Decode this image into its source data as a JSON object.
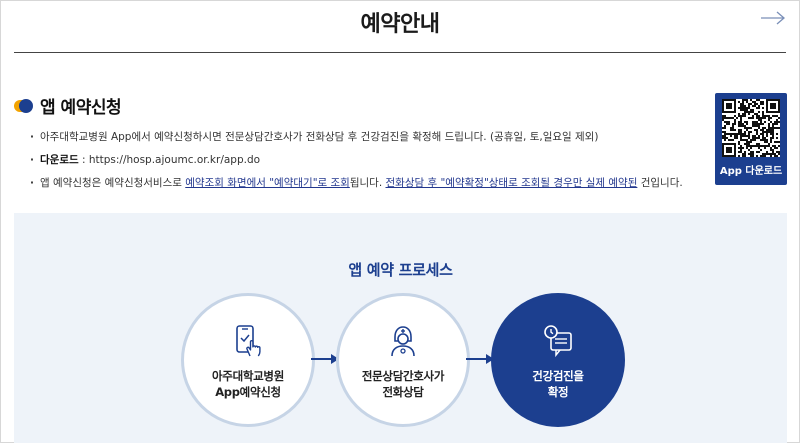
{
  "header": {
    "title": "예약안내",
    "next_icon": "arrow-right-icon"
  },
  "section": {
    "title": "앱 예약신청",
    "icon": "section-bullet-icon"
  },
  "info": {
    "line1": "아주대학교병원 App에서 예약신청하시면 전문상담간호사가 전화상담 후 건강검진을 확정해 드립니다. (공휴일, 토,일요일 제외)",
    "download_label": "다운로드",
    "download_sep": " : ",
    "download_url": "https://hosp.ajoumc.or.kr/app.do",
    "line3_a": "앱 예약신청은 예약신청서비스로 ",
    "line3_link1": "예약조회 화면에서 \"예약대기\"로 조회",
    "line3_b": "됩니다. ",
    "line3_link2": "전화상담 후 \"예약확정\"상태로 조회될 경우만 실제 예약된",
    "line3_c": " 건입니다."
  },
  "qr": {
    "label": "App 다운로드",
    "icon": "qr-code-icon"
  },
  "process": {
    "title": "앱 예약 프로세스",
    "steps": [
      {
        "line1": "아주대학교병원",
        "line2": "App예약신청",
        "icon": "smartphone-touch-icon"
      },
      {
        "line1": "전문상담간호사가",
        "line2": "전화상담",
        "icon": "nurse-icon"
      },
      {
        "line1": "건강검진을",
        "line2": "확정",
        "icon": "clock-document-icon"
      }
    ]
  },
  "colors": {
    "primary": "#1c3f8f",
    "accent": "#f2a300",
    "panel_bg": "#eef3f9",
    "circle_border": "#c6d4e6"
  }
}
